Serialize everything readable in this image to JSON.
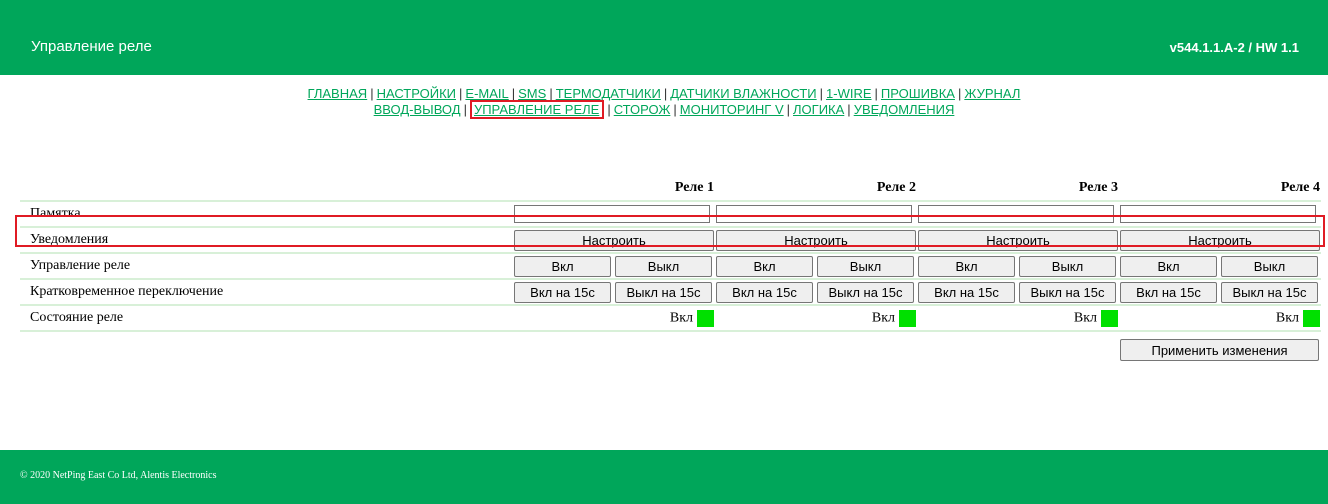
{
  "header": {
    "title": "Управление реле",
    "version": "v544.1.1.A-2 / HW 1.1"
  },
  "nav": {
    "row1": [
      "ГЛАВНАЯ",
      "НАСТРОЙКИ",
      "E-MAIL",
      "SMS",
      "ТЕРМОДАТЧИКИ",
      "ДАТЧИКИ ВЛАЖНОСТИ",
      "1-WIRE",
      "ПРОШИВКА",
      "ЖУРНАЛ"
    ],
    "row2": [
      "ВВОД-ВЫВОД",
      "УПРАВЛЕНИЕ РЕЛЕ",
      "СТОРОЖ",
      "МОНИТОРИНГ V",
      "ЛОГИКА",
      "УВЕДОМЛЕНИЯ"
    ],
    "active": "УПРАВЛЕНИЕ РЕЛЕ"
  },
  "table": {
    "relays": [
      "Реле 1",
      "Реле 2",
      "Реле 3",
      "Реле 4"
    ],
    "rows": {
      "memo": "Памятка",
      "notifications": "Уведомления",
      "control": "Управление реле",
      "pulse": "Кратковременное переключение",
      "state": "Состояние реле"
    },
    "configure_label": "Настроить",
    "on_label": "Вкл",
    "off_label": "Выкл",
    "pulse_on_label": "Вкл на 15с",
    "pulse_off_label": "Выкл на 15с",
    "states": [
      "Вкл",
      "Вкл",
      "Вкл",
      "Вкл"
    ],
    "memo_values": [
      "",
      "",
      "",
      ""
    ]
  },
  "apply_label": "Применить изменения",
  "footer": {
    "copyright": "© 2020 NetPing East Co Ltd, Alentis Electronics"
  },
  "colors": {
    "brand": "#00a65a",
    "state_on": "#00e000",
    "highlight": "#e01b24"
  }
}
